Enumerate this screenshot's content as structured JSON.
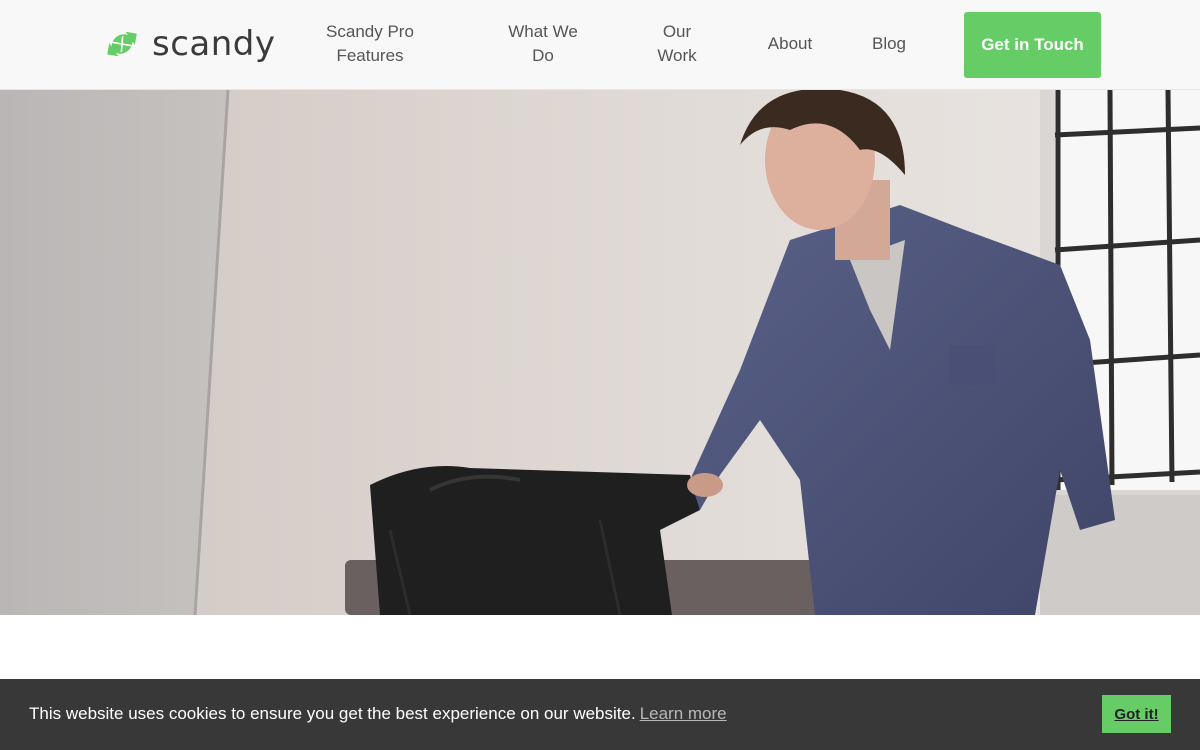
{
  "brand": {
    "name": "scandy",
    "accent_color": "#66cc66",
    "icon": "candy-logo-icon"
  },
  "nav": {
    "items": [
      {
        "label": "Scandy Pro Features"
      },
      {
        "label": "What We Do"
      },
      {
        "label": "Our Work"
      },
      {
        "label": "About"
      },
      {
        "label": "Blog"
      }
    ],
    "cta_label": "Get in Touch"
  },
  "hero": {
    "image": "man-with-black-duffel-bag-photo"
  },
  "cookie_banner": {
    "message": "This website uses cookies to ensure you get the best experience on our website.",
    "link_label": "Learn more",
    "button_label": "Got it!",
    "background_color": "#383838"
  }
}
